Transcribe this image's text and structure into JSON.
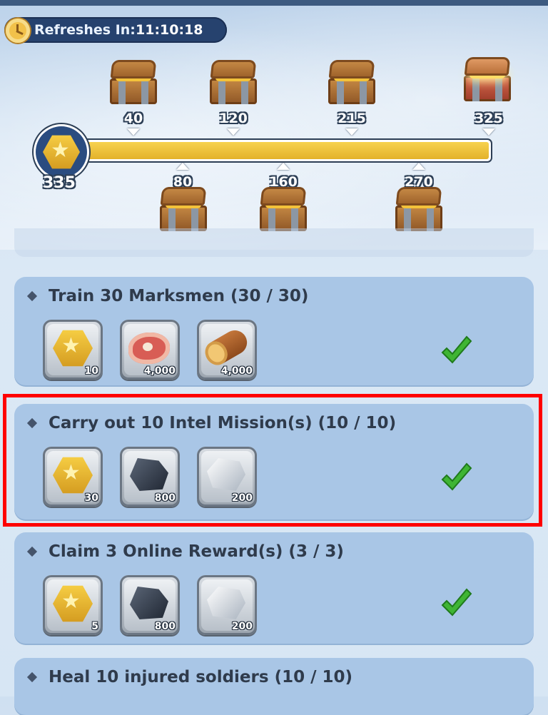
{
  "refresh": {
    "label": "Refreshes In:",
    "time": "11:10:18"
  },
  "points": {
    "current": "335",
    "progress_fraction": 1.0,
    "max": 325
  },
  "milestones_top": [
    {
      "value": "40",
      "chest": "wooden-chest"
    },
    {
      "value": "120",
      "chest": "wooden-chest"
    },
    {
      "value": "215",
      "chest": "wooden-chest"
    },
    {
      "value": "325",
      "chest": "golden-chest"
    }
  ],
  "milestones_bottom": [
    {
      "value": "80",
      "chest": "wooden-chest"
    },
    {
      "value": "160",
      "chest": "wooden-chest"
    },
    {
      "value": "270",
      "chest": "wooden-chest"
    }
  ],
  "tasks": [
    {
      "title": "Train 30 Marksmen (30 / 30)",
      "rewards": [
        {
          "icon": "activity-coin-icon",
          "qty": "10"
        },
        {
          "icon": "meat-icon",
          "qty": "4,000"
        },
        {
          "icon": "wood-log-icon",
          "qty": "4,000"
        }
      ],
      "completed": true
    },
    {
      "title": "Carry out 10 Intel Mission(s) (10 / 10)",
      "rewards": [
        {
          "icon": "activity-coin-icon",
          "qty": "30"
        },
        {
          "icon": "coal-icon",
          "qty": "800"
        },
        {
          "icon": "iron-ore-icon",
          "qty": "200"
        }
      ],
      "completed": true
    },
    {
      "title": "Claim 3 Online Reward(s) (3 / 3)",
      "rewards": [
        {
          "icon": "activity-coin-icon",
          "qty": "5"
        },
        {
          "icon": "coal-icon",
          "qty": "800"
        },
        {
          "icon": "iron-ore-icon",
          "qty": "200"
        }
      ],
      "completed": true
    },
    {
      "title": "Heal 10 injured soldiers (10 / 10)",
      "rewards": [],
      "completed": true
    }
  ],
  "colors": {
    "highlight": "#ff0000",
    "bar_fill": "#e3b22a",
    "check": "#3fb534"
  }
}
